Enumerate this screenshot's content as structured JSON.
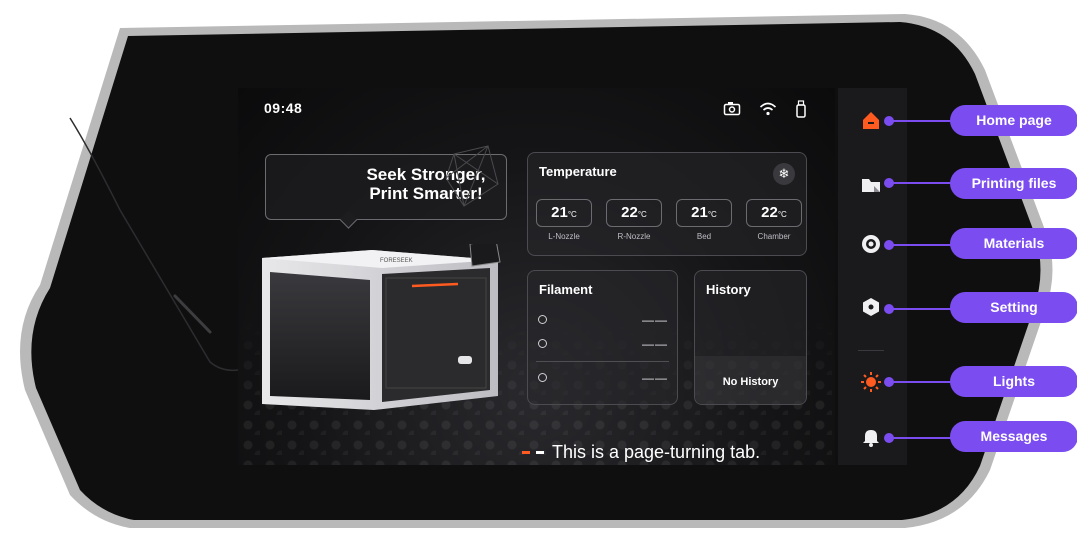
{
  "status_bar": {
    "time": "09:48",
    "icons": [
      "camera-icon",
      "wifi-icon",
      "usb-icon"
    ]
  },
  "banner": {
    "line1": "Seek Stronger,",
    "line2": "Print Smarter!"
  },
  "printer": {
    "brand": "FORESEEK"
  },
  "temperature": {
    "title": "Temperature",
    "unit": "°C",
    "items": [
      {
        "value": "21",
        "label": "L-Nozzle"
      },
      {
        "value": "22",
        "label": "R-Nozzle"
      },
      {
        "value": "21",
        "label": "Bed"
      },
      {
        "value": "22",
        "label": "Chamber"
      }
    ]
  },
  "filament": {
    "title": "Filament",
    "slots": [
      {
        "value": "——"
      },
      {
        "value": "——"
      },
      {
        "value": "——"
      }
    ]
  },
  "history": {
    "title": "History",
    "empty_text": "No History"
  },
  "page_indicator": {
    "note": "This is a page-turning tab.",
    "active_color": "#ff5a1f",
    "inactive_color": "#ffffff"
  },
  "sidebar": {
    "accent_color": "#ff5a1f",
    "items": [
      {
        "icon": "home-icon",
        "label": "Home page",
        "active": true
      },
      {
        "icon": "folder-icon",
        "label": "Printing files"
      },
      {
        "icon": "spool-icon",
        "label": "Materials"
      },
      {
        "icon": "hex-nut-icon",
        "label": "Setting"
      },
      {
        "icon": "light-icon",
        "label": "Lights"
      },
      {
        "icon": "bell-icon",
        "label": "Messages"
      }
    ]
  },
  "callout_color": "#7b4cf0"
}
